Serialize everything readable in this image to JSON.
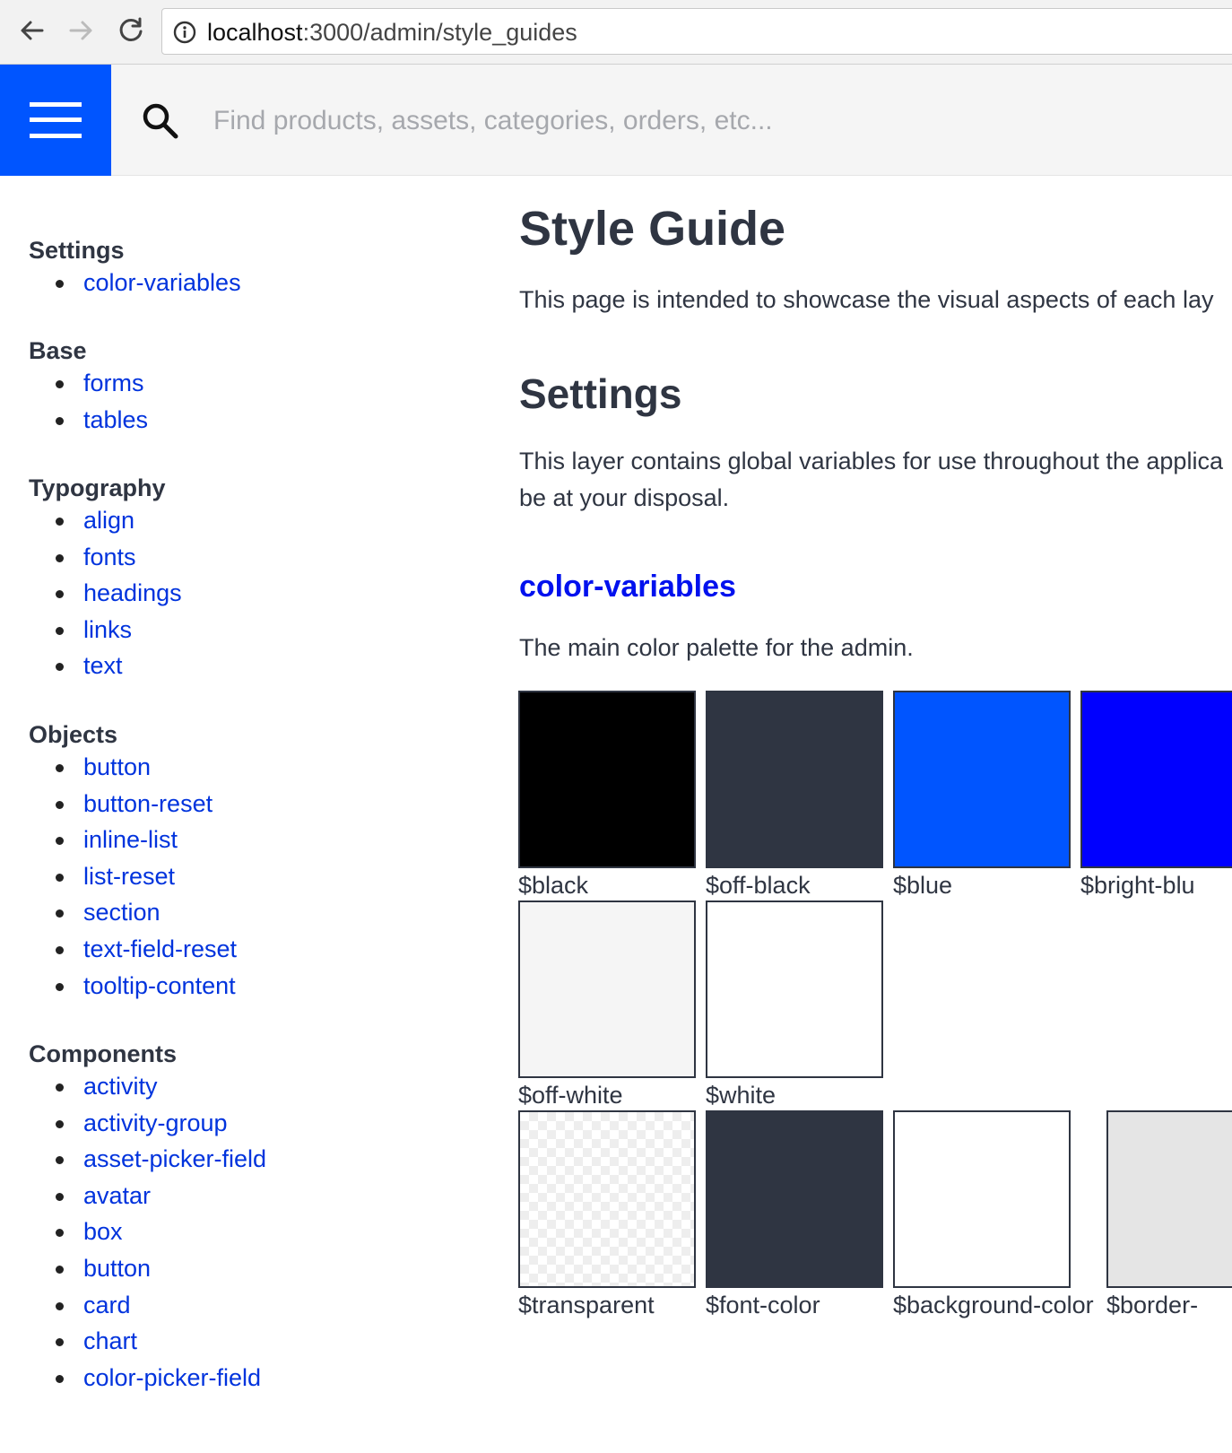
{
  "browser": {
    "url_host": "localhost",
    "url_path": ":3000/admin/style_guides"
  },
  "header": {
    "search_placeholder": "Find products, assets, categories, orders, etc..."
  },
  "sidebar": {
    "groups": [
      {
        "heading": "Settings",
        "items": [
          "color-variables"
        ]
      },
      {
        "heading": "Base",
        "items": [
          "forms",
          "tables"
        ]
      },
      {
        "heading": "Typography",
        "items": [
          "align",
          "fonts",
          "headings",
          "links",
          "text"
        ]
      },
      {
        "heading": "Objects",
        "items": [
          "button",
          "button-reset",
          "inline-list",
          "list-reset",
          "section",
          "text-field-reset",
          "tooltip-content"
        ]
      },
      {
        "heading": "Components",
        "items": [
          "activity",
          "activity-group",
          "asset-picker-field",
          "avatar",
          "box",
          "button",
          "card",
          "chart",
          "color-picker-field"
        ]
      }
    ]
  },
  "main": {
    "title": "Style Guide",
    "intro": "This page is intended to showcase the visual aspects of each lay",
    "section_title": "Settings",
    "section_desc_line1": "This layer contains global variables for use throughout the applica",
    "section_desc_line2": "be at your disposal.",
    "subsection_title": "color-variables",
    "subsection_desc": "The main color palette for the admin.",
    "swatches": [
      {
        "label": "$black",
        "color": "#000000"
      },
      {
        "label": "$off-black",
        "color": "#2f3542"
      },
      {
        "label": "$blue",
        "color": "#0055ff"
      },
      {
        "label": "$bright-blu",
        "color": "#0000ff"
      },
      {
        "label": "$off-white",
        "color": "#f5f5f5"
      },
      {
        "label": "$white",
        "color": "#ffffff"
      },
      {
        "label": "$transparent",
        "color": "transparent"
      },
      {
        "label": "$font-color",
        "color": "#2f3542"
      },
      {
        "label": "$background-color",
        "color": "#ffffff"
      },
      {
        "label": "$border-",
        "color": "#e5e5e5"
      }
    ]
  },
  "colors": {
    "brand_blue": "#0055ff",
    "link_blue": "#0033dd",
    "heading_blue": "#0011ee",
    "text": "#2f3542"
  }
}
